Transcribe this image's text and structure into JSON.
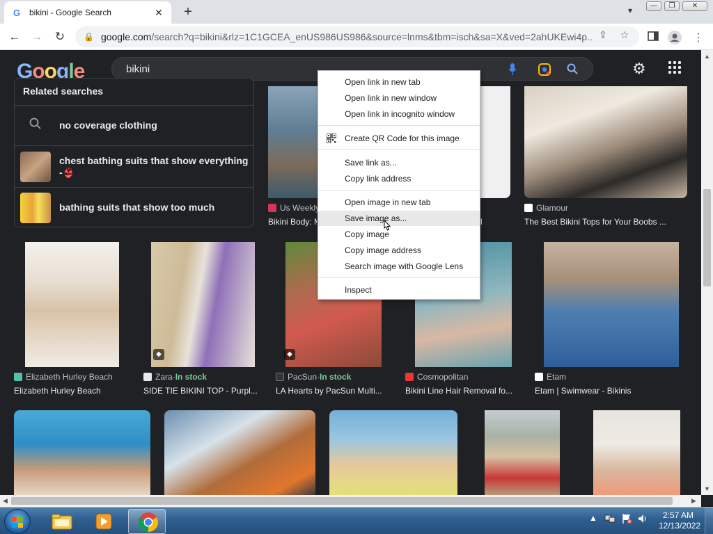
{
  "browser": {
    "tab_title": "bikini - Google Search",
    "tab_close": "✕",
    "new_tab": "+",
    "url_main": "google.com",
    "url_rest": "/search?q=bikini&rlz=1C1GCEA_enUS986US986&source=lnms&tbm=isch&sa=X&ved=2ahUKEwi4p...",
    "window_controls": {
      "minimize": "—",
      "restore": "❐",
      "close": "✕"
    }
  },
  "google": {
    "logo": "Google",
    "query": "bikini"
  },
  "related": {
    "heading": "Related searches",
    "items": [
      {
        "label": "no coverage clothing",
        "icon": "search-icon"
      },
      {
        "label": "chest bathing suits that show everything",
        "label2": "-👙",
        "icon": "thumbnail"
      },
      {
        "label": "bathing suits that show too much",
        "icon": "thumbnail"
      }
    ]
  },
  "results_row1": [
    {
      "source": "Us Weekly",
      "title": "Bikini Body: M...",
      "src_color": "#d8335a"
    },
    {
      "source": "",
      "title": "l",
      "src_color": ""
    },
    {
      "source": "Glamour",
      "title": "The Best Bikini Tops for Your Boobs ...",
      "src_color": "#ffffff"
    }
  ],
  "results_row2": [
    {
      "source": "Elizabeth Hurley Beach",
      "stock": "",
      "title": "Elizabeth Hurley Beach",
      "src_color": "#52c0a8"
    },
    {
      "source": "Zara",
      "stock": "In stock",
      "title": "SIDE TIE BIKINI TOP - Purpl...",
      "src_color": "#e8eaed"
    },
    {
      "source": "PacSun",
      "stock": "In stock",
      "title": "LA Hearts by PacSun Multi...",
      "src_color": "#333333"
    },
    {
      "source": "Cosmopolitan",
      "stock": "",
      "title": "Bikini Line Hair Removal fo...",
      "src_color": "#e53935"
    },
    {
      "source": "Etam",
      "stock": "",
      "title": "Etam | Swimwear - Bikinis",
      "src_color": "#ffffff"
    }
  ],
  "in_stock_sep": " · ",
  "context_menu": {
    "items": [
      "Open link in new tab",
      "Open link in new window",
      "Open link in incognito window",
      "Create QR Code for this image",
      "Save link as...",
      "Copy link address",
      "Open image in new tab",
      "Save image as...",
      "Copy image",
      "Copy image address",
      "Search image with Google Lens",
      "Inspect"
    ],
    "highlighted": "Save image as..."
  },
  "taskbar": {
    "time": "2:57 AM",
    "date": "12/13/2022"
  },
  "colors": {
    "page_bg": "#202124",
    "in_stock": "#81c995",
    "taskbar": "#2f5e8e"
  }
}
